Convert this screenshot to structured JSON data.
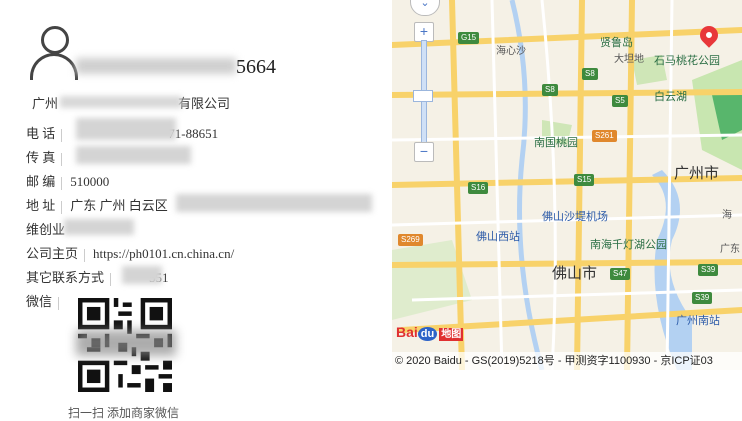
{
  "contact": {
    "phone_tail": "5664",
    "company_prefix": "广州",
    "company_suffix": "有限公司",
    "rows": [
      {
        "label": "电 话",
        "value": "71-88651"
      },
      {
        "label": "传 真",
        "value": ""
      },
      {
        "label": "邮 编",
        "value": "510000"
      },
      {
        "label": "地 址",
        "value": "广东 广州 白云区"
      },
      {
        "label": "维创业",
        "value": ""
      },
      {
        "label": "公司主页",
        "value": "https://ph0101.cn.china.cn/"
      },
      {
        "label": "其它联系方式",
        "value": "551"
      },
      {
        "label": "微信",
        "value": ""
      }
    ],
    "qr_caption": "扫一扫 添加商家微信"
  },
  "map": {
    "copyright": "© 2020 Baidu - GS(2019)5218号 - 甲测资字1100930 - 京ICP证03",
    "logo_text": "Bai",
    "logo_du": "du",
    "logo_tu": "地图",
    "zoom_in": "+",
    "zoom_out": "−",
    "places": {
      "yilu_dao": "贤鲁岛",
      "dayan_di": "大坦地",
      "shima_taohua": "石马桃花公园",
      "baiyun_hu": "白云湖",
      "haixin_sha": "海心沙",
      "nanguo_taoyuan": "南国桃园",
      "guangzhou_shi": "广州市",
      "foshan_airport": "佛山沙堤机场",
      "foshan_west": "佛山西站",
      "nanhai_qiandeng": "南海千灯湖公园",
      "foshan_shi": "佛山市",
      "guangzhou_south": "广州南站",
      "hai": "海",
      "guangdong": "广东"
    },
    "shields": {
      "g15": "G15",
      "s8a": "S8",
      "s8b": "S8",
      "s5": "S5",
      "s261": "S261",
      "s15": "S15",
      "s16": "S16",
      "s269": "S269",
      "s47": "S47",
      "s39a": "S39",
      "s39b": "S39"
    }
  },
  "colors": {
    "road_yellow": "#f8d26a",
    "road_white": "#ffffff",
    "water": "#b3d1f2",
    "green": "#c8e6b0",
    "pin_red": "#e8373a"
  }
}
